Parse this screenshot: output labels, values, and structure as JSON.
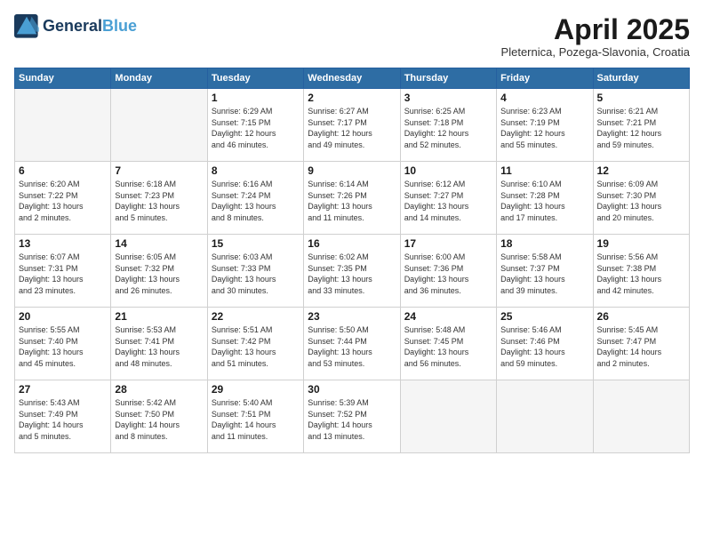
{
  "header": {
    "logo_line1": "General",
    "logo_line2": "Blue",
    "title": "April 2025",
    "location": "Pleternica, Pozega-Slavonia, Croatia"
  },
  "weekdays": [
    "Sunday",
    "Monday",
    "Tuesday",
    "Wednesday",
    "Thursday",
    "Friday",
    "Saturday"
  ],
  "weeks": [
    [
      {
        "day": "",
        "content": ""
      },
      {
        "day": "",
        "content": ""
      },
      {
        "day": "1",
        "content": "Sunrise: 6:29 AM\nSunset: 7:15 PM\nDaylight: 12 hours\nand 46 minutes."
      },
      {
        "day": "2",
        "content": "Sunrise: 6:27 AM\nSunset: 7:17 PM\nDaylight: 12 hours\nand 49 minutes."
      },
      {
        "day": "3",
        "content": "Sunrise: 6:25 AM\nSunset: 7:18 PM\nDaylight: 12 hours\nand 52 minutes."
      },
      {
        "day": "4",
        "content": "Sunrise: 6:23 AM\nSunset: 7:19 PM\nDaylight: 12 hours\nand 55 minutes."
      },
      {
        "day": "5",
        "content": "Sunrise: 6:21 AM\nSunset: 7:21 PM\nDaylight: 12 hours\nand 59 minutes."
      }
    ],
    [
      {
        "day": "6",
        "content": "Sunrise: 6:20 AM\nSunset: 7:22 PM\nDaylight: 13 hours\nand 2 minutes."
      },
      {
        "day": "7",
        "content": "Sunrise: 6:18 AM\nSunset: 7:23 PM\nDaylight: 13 hours\nand 5 minutes."
      },
      {
        "day": "8",
        "content": "Sunrise: 6:16 AM\nSunset: 7:24 PM\nDaylight: 13 hours\nand 8 minutes."
      },
      {
        "day": "9",
        "content": "Sunrise: 6:14 AM\nSunset: 7:26 PM\nDaylight: 13 hours\nand 11 minutes."
      },
      {
        "day": "10",
        "content": "Sunrise: 6:12 AM\nSunset: 7:27 PM\nDaylight: 13 hours\nand 14 minutes."
      },
      {
        "day": "11",
        "content": "Sunrise: 6:10 AM\nSunset: 7:28 PM\nDaylight: 13 hours\nand 17 minutes."
      },
      {
        "day": "12",
        "content": "Sunrise: 6:09 AM\nSunset: 7:30 PM\nDaylight: 13 hours\nand 20 minutes."
      }
    ],
    [
      {
        "day": "13",
        "content": "Sunrise: 6:07 AM\nSunset: 7:31 PM\nDaylight: 13 hours\nand 23 minutes."
      },
      {
        "day": "14",
        "content": "Sunrise: 6:05 AM\nSunset: 7:32 PM\nDaylight: 13 hours\nand 26 minutes."
      },
      {
        "day": "15",
        "content": "Sunrise: 6:03 AM\nSunset: 7:33 PM\nDaylight: 13 hours\nand 30 minutes."
      },
      {
        "day": "16",
        "content": "Sunrise: 6:02 AM\nSunset: 7:35 PM\nDaylight: 13 hours\nand 33 minutes."
      },
      {
        "day": "17",
        "content": "Sunrise: 6:00 AM\nSunset: 7:36 PM\nDaylight: 13 hours\nand 36 minutes."
      },
      {
        "day": "18",
        "content": "Sunrise: 5:58 AM\nSunset: 7:37 PM\nDaylight: 13 hours\nand 39 minutes."
      },
      {
        "day": "19",
        "content": "Sunrise: 5:56 AM\nSunset: 7:38 PM\nDaylight: 13 hours\nand 42 minutes."
      }
    ],
    [
      {
        "day": "20",
        "content": "Sunrise: 5:55 AM\nSunset: 7:40 PM\nDaylight: 13 hours\nand 45 minutes."
      },
      {
        "day": "21",
        "content": "Sunrise: 5:53 AM\nSunset: 7:41 PM\nDaylight: 13 hours\nand 48 minutes."
      },
      {
        "day": "22",
        "content": "Sunrise: 5:51 AM\nSunset: 7:42 PM\nDaylight: 13 hours\nand 51 minutes."
      },
      {
        "day": "23",
        "content": "Sunrise: 5:50 AM\nSunset: 7:44 PM\nDaylight: 13 hours\nand 53 minutes."
      },
      {
        "day": "24",
        "content": "Sunrise: 5:48 AM\nSunset: 7:45 PM\nDaylight: 13 hours\nand 56 minutes."
      },
      {
        "day": "25",
        "content": "Sunrise: 5:46 AM\nSunset: 7:46 PM\nDaylight: 13 hours\nand 59 minutes."
      },
      {
        "day": "26",
        "content": "Sunrise: 5:45 AM\nSunset: 7:47 PM\nDaylight: 14 hours\nand 2 minutes."
      }
    ],
    [
      {
        "day": "27",
        "content": "Sunrise: 5:43 AM\nSunset: 7:49 PM\nDaylight: 14 hours\nand 5 minutes."
      },
      {
        "day": "28",
        "content": "Sunrise: 5:42 AM\nSunset: 7:50 PM\nDaylight: 14 hours\nand 8 minutes."
      },
      {
        "day": "29",
        "content": "Sunrise: 5:40 AM\nSunset: 7:51 PM\nDaylight: 14 hours\nand 11 minutes."
      },
      {
        "day": "30",
        "content": "Sunrise: 5:39 AM\nSunset: 7:52 PM\nDaylight: 14 hours\nand 13 minutes."
      },
      {
        "day": "",
        "content": ""
      },
      {
        "day": "",
        "content": ""
      },
      {
        "day": "",
        "content": ""
      }
    ]
  ]
}
